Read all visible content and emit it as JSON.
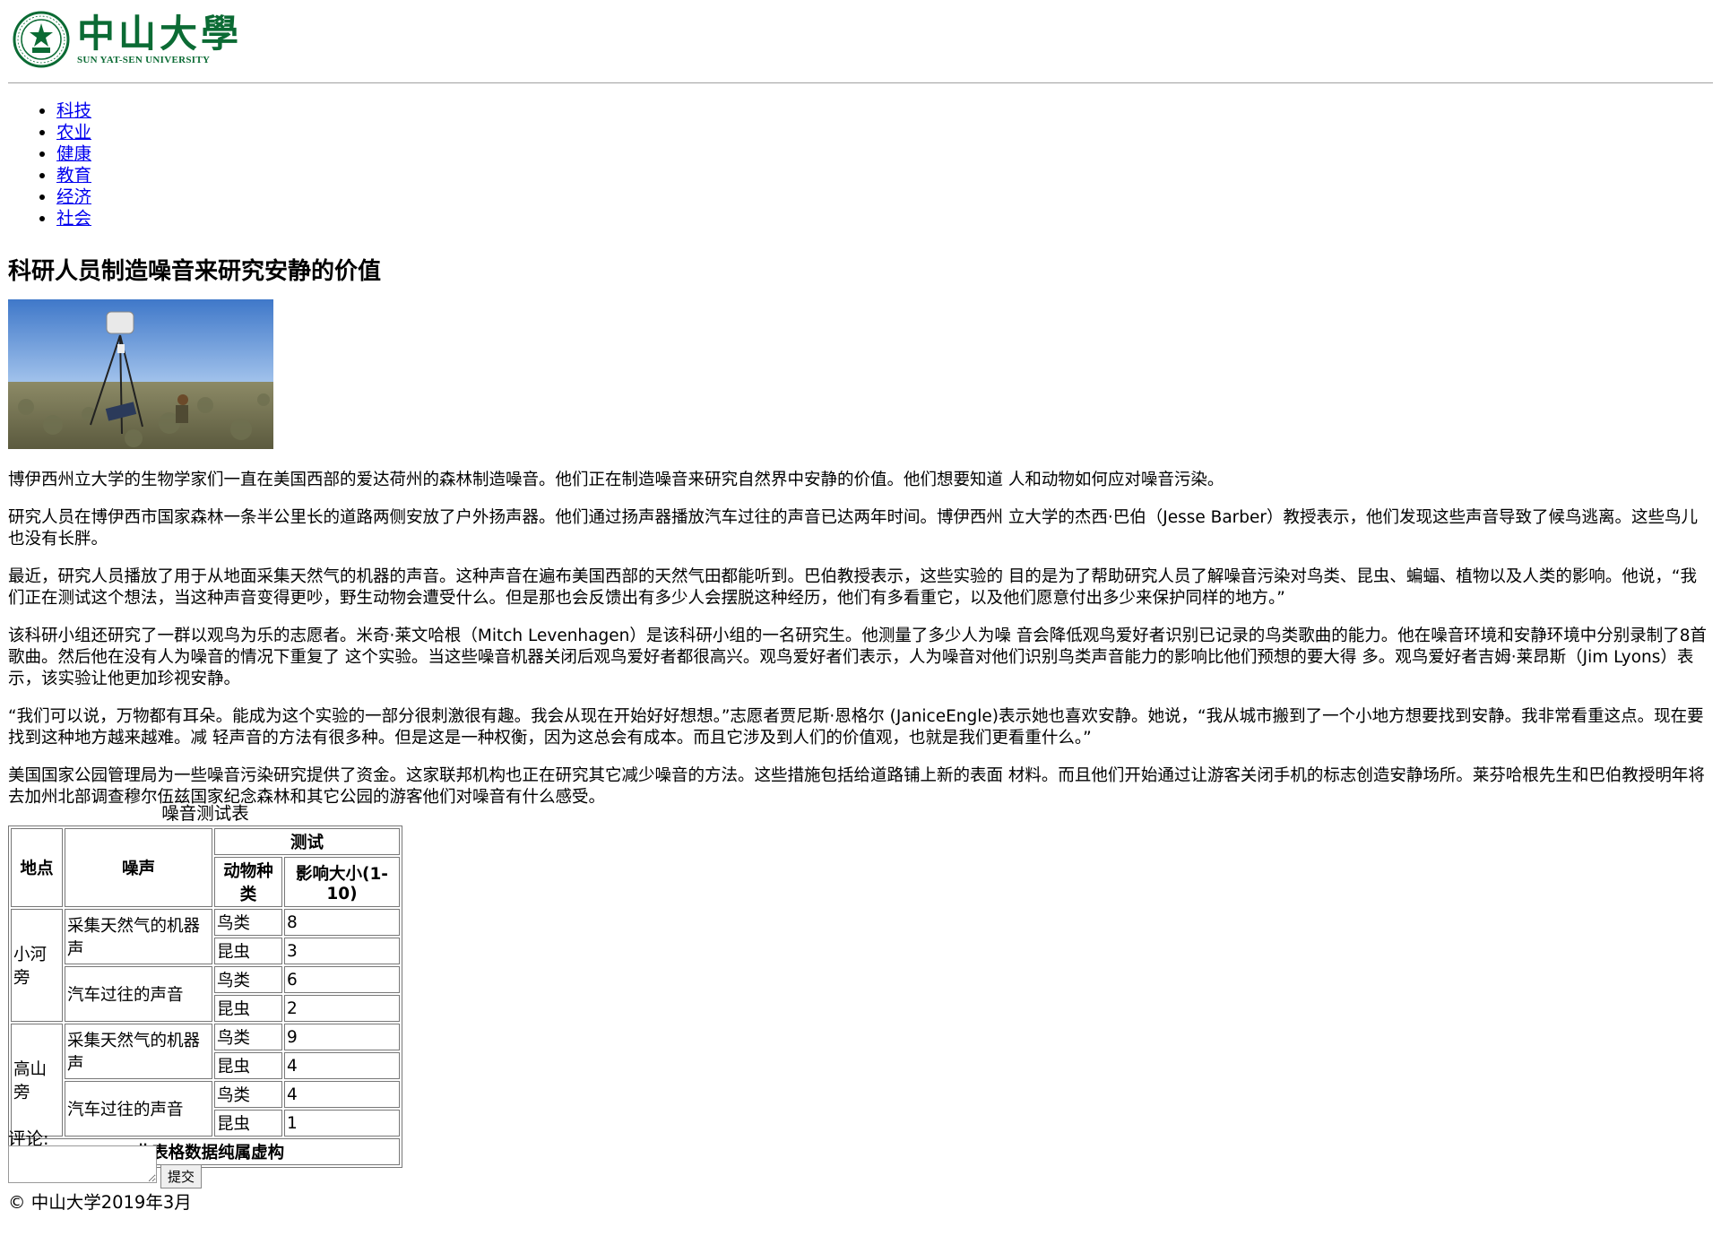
{
  "header": {
    "logo_cn": "中山大學",
    "logo_en": "SUN YAT-SEN UNIVERSITY",
    "brand_color": "#0b6b34"
  },
  "nav": [
    "科技",
    "农业",
    "健康",
    "教育",
    "经济",
    "社会"
  ],
  "article": {
    "title": "科研人员制造噪音来研究安静的价值",
    "paragraphs": [
      "博伊西州立大学的生物学家们一直在美国西部的爱达荷州的森林制造噪音。他们正在制造噪音来研究自然界中安静的价值。他们想要知道 人和动物如何应对噪音污染。",
      "研究人员在博伊西市国家森林一条半公里长的道路两侧安放了户外扬声器。他们通过扬声器播放汽车过往的声音已达两年时间。博伊西州 立大学的杰西·巴伯（Jesse Barber）教授表示，他们发现这些声音导致了候鸟逃离。这些鸟儿也没有长胖。",
      "最近，研究人员播放了用于从地面采集天然气的机器的声音。这种声音在遍布美国西部的天然气田都能听到。巴伯教授表示，这些实验的 目的是为了帮助研究人员了解噪音污染对鸟类、昆虫、蝙蝠、植物以及人类的影响。他说，“我们正在测试这个想法，当这种声音变得更吵，野生动物会遭受什么。但是那也会反馈出有多少人会摆脱这种经历，他们有多看重它，以及他们愿意付出多少来保护同样的地方。”",
      "该科研小组还研究了一群以观鸟为乐的志愿者。米奇·莱文哈根（Mitch Levenhagen）是该科研小组的一名研究生。他测量了多少人为噪 音会降低观鸟爱好者识别已记录的鸟类歌曲的能力。他在噪音环境和安静环境中分别录制了8首歌曲。然后他在没有人为噪音的情况下重复了 这个实验。当这些噪音机器关闭后观鸟爱好者都很高兴。观鸟爱好者们表示，人为噪音对他们识别鸟类声音能力的影响比他们预想的要大得 多。观鸟爱好者吉姆·莱昂斯（Jim Lyons）表示，该实验让他更加珍视安静。",
      "“我们可以说，万物都有耳朵。能成为这个实验的一部分很刺激很有趣。我会从现在开始好好想想。”志愿者贾尼斯·恩格尔 (JaniceEngle)表示她也喜欢安静。她说，“我从城市搬到了一个小地方想要找到安静。我非常看重这点。现在要找到这种地方越来越难。减 轻声音的方法有很多种。但是这是一种权衡，因为这总会有成本。而且它涉及到人们的价值观，也就是我们更看重什么。”",
      "美国国家公园管理局为一些噪音污染研究提供了资金。这家联邦机构也正在研究其它减少噪音的方法。这些措施包括给道路铺上新的表面 材料。而且他们开始通过让游客关闭手机的标志创造安静场所。莱芬哈根先生和巴伯教授明年将去加州北部调查穆尔伍兹国家纪念森林和其它公园的游客他们对噪音有什么感受。"
    ]
  },
  "table": {
    "caption": "噪音测试表",
    "headers": {
      "location": "地点",
      "noise": "噪声",
      "test": "测试",
      "species": "动物种类",
      "impact": "影响大小(1-10)"
    },
    "groups": [
      {
        "location": "小河旁",
        "noises": [
          {
            "noise": "采集天然气的机器声",
            "rows": [
              {
                "species": "鸟类",
                "impact": "8"
              },
              {
                "species": "昆虫",
                "impact": "3"
              }
            ]
          },
          {
            "noise": "汽车过往的声音",
            "rows": [
              {
                "species": "鸟类",
                "impact": "6"
              },
              {
                "species": "昆虫",
                "impact": "2"
              }
            ]
          }
        ]
      },
      {
        "location": "高山旁",
        "noises": [
          {
            "noise": "采集天然气的机器声",
            "rows": [
              {
                "species": "鸟类",
                "impact": "9"
              },
              {
                "species": "昆虫",
                "impact": "4"
              }
            ]
          },
          {
            "noise": "汽车过往的声音",
            "rows": [
              {
                "species": "鸟类",
                "impact": "4"
              },
              {
                "species": "昆虫",
                "impact": "1"
              }
            ]
          }
        ]
      }
    ],
    "footnote": "*此表格数据纯属虚构"
  },
  "comment": {
    "label": "评论:",
    "value": "",
    "submit_label": "提交"
  },
  "footer": "© 中山大学2019年3月"
}
